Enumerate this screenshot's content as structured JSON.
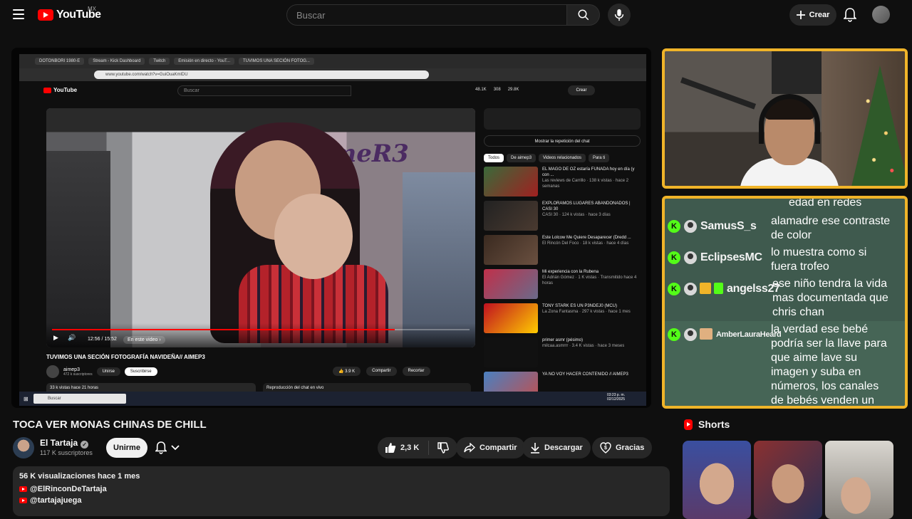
{
  "header": {
    "logo_text": "YouTube",
    "country_code": "MX",
    "search_placeholder": "Buscar",
    "create_label": "Crear"
  },
  "inner_screen": {
    "tabs": [
      "DOTONBORI 1980-E",
      "Stream - Kick Dashboard",
      "Twitch",
      "Emisión en directo - YouT...",
      "TUVIMOS UNA SECIÓN FOTOG..."
    ],
    "url": "www.youtube.com/watch?v=GuiOuaKmlDU",
    "search_placeholder": "Buscar",
    "stats": [
      "48.1K",
      "308",
      "29.8K"
    ],
    "create_label": "Crear",
    "watermark": "AimeR3",
    "time": "12:56 / 15:52",
    "chapter_chip": "En este video ›",
    "progress": 0.82,
    "video_title": "TUVIMOS UNA SECIÓN FOTOGRAFÍA NAVIDEÑA// AIMEP3",
    "channel": "aimep3",
    "channel_subs": "472 k suscriptores",
    "join_label": "Unirse",
    "subscribed_label": "Suscribirse",
    "likes": "3.9 K",
    "share_label": "Compartir",
    "clip_label": "Recortar",
    "desc_meta": "33 k vistas  hace 21 horas",
    "chat_replay": "Reproducción del chat en vivo",
    "chat_replay_button": "Mostrar la repetición del chat",
    "chips": [
      "Todos",
      "De aimep3",
      "Videos relacionados",
      "Para ti"
    ],
    "recommendations": [
      {
        "title": "EL MAGO DE OZ estaría FUNADA hoy en día (y con ...",
        "meta": "Las reviews de Carrillo · 138 k vistas · hace 2 semanas"
      },
      {
        "title": "EXPLORAMOS LUGARES ABANDONADOS | CASI 30",
        "meta": "CASI 30 · 124 k vistas · hace 3 días"
      },
      {
        "title": "Este Lolcow Me Quiere Desaparecer (Dredd ...",
        "meta": "El Rincón Del Foco · 18 k vistas · hace 4 días"
      },
      {
        "title": "Mi experiencia con la Rubena",
        "meta": "El Adrián Gómez · 1 K vistas · Transmitido hace 4 horas"
      },
      {
        "title": "TONY STARK ES UN P3NDEJ0 (MCU)",
        "meta": "La Zona Fantasma · 297 k vistas · hace 1 mes"
      },
      {
        "title": "primer asmr (pésimo)",
        "meta": "milcaa.asmrrr · 3.4 K vistas · hace 3 meses"
      },
      {
        "title": "YA NO VOY HACER CONTENIDO // AIMEP3",
        "meta": ""
      }
    ],
    "taskbar_search": "Buscar",
    "clock": "03:23 p. m.",
    "date": "02/12/2025"
  },
  "chat": {
    "partial_text": "edad en redes",
    "messages": [
      {
        "user": "SamusS_s",
        "text": "alamadre ese contraste de color"
      },
      {
        "user": "EclipsesMC",
        "text": "lo muestra como si fuera trofeo"
      },
      {
        "user": "angelss27",
        "text": "ese niño tendra la vida mas documentada que chris chan"
      },
      {
        "user": "AmberLauraHeard",
        "text": "la verdad ese bebé podría ser la llave para que aime lave su imagen y suba en números, los canales de bebés venden un monton"
      }
    ],
    "accent_color": "#f0b429",
    "kick_color": "#53fc18"
  },
  "video": {
    "title": "TOCA VER MONAS CHINAS DE CHILL",
    "channel": "El Tartaja",
    "subscribers": "117 K suscriptores",
    "join_label": "Unirme",
    "likes": "2,3 K",
    "share_label": "Compartir",
    "download_label": "Descargar",
    "thanks_label": "Gracias",
    "description_meta": "56 K visualizaciones  hace 1 mes",
    "links": [
      "@ElRinconDeTartaja",
      "@tartajajuega"
    ]
  },
  "shorts": {
    "heading": "Shorts"
  }
}
